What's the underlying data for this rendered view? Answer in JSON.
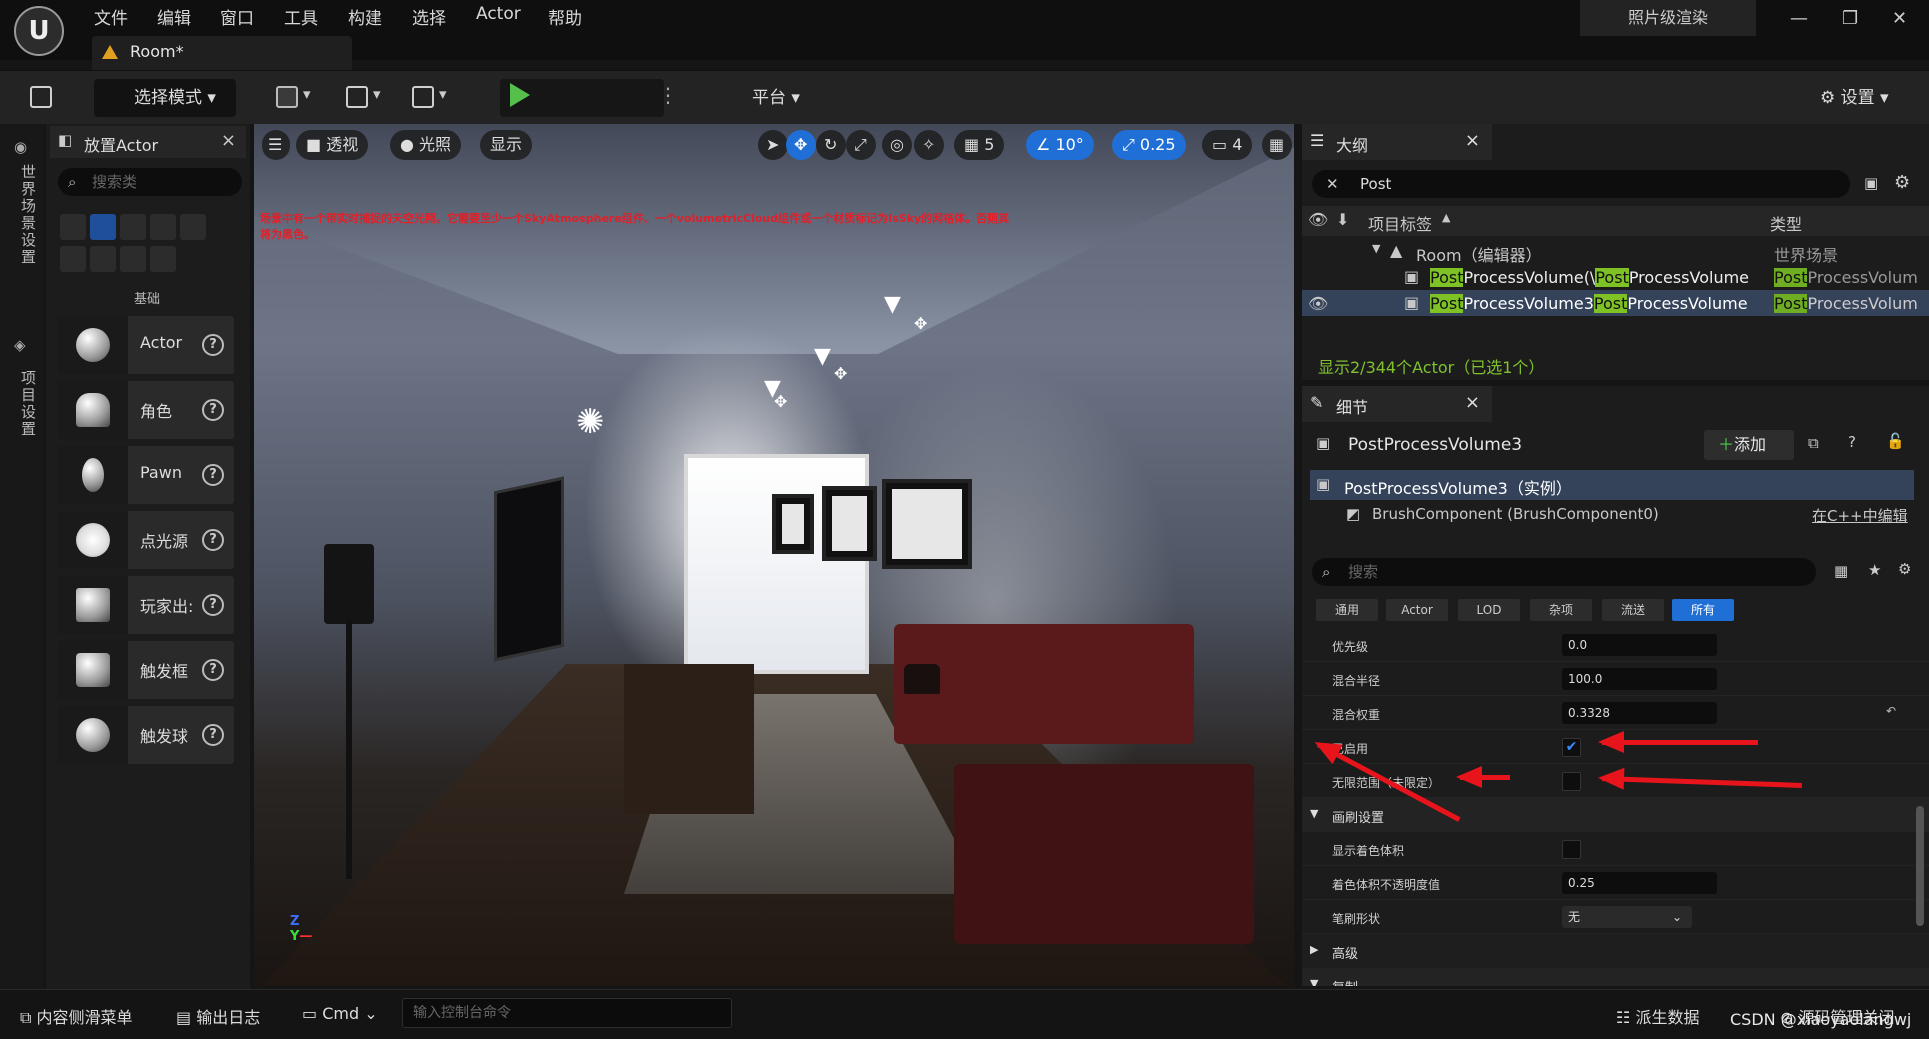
{
  "menu": {
    "items": [
      "文件",
      "编辑",
      "窗口",
      "工具",
      "构建",
      "选择",
      "Actor",
      "帮助"
    ],
    "doc_tab": "Room*",
    "photo_render": "照片级渲染"
  },
  "toolbar": {
    "mode": "选择模式",
    "platform": "平台",
    "settings": "设置"
  },
  "left_rail": {
    "world_settings": "世界场景设置",
    "project_settings": "项目设置"
  },
  "place_actor": {
    "title": "放置Actor",
    "search_placeholder": "搜索类",
    "section": "基础",
    "items": [
      {
        "label": "Actor"
      },
      {
        "label": "角色"
      },
      {
        "label": "Pawn"
      },
      {
        "label": "点光源"
      },
      {
        "label": "玩家出:"
      },
      {
        "label": "触发框"
      },
      {
        "label": "触发球"
      }
    ]
  },
  "viewport": {
    "perspective": "透视",
    "lighting": "光照",
    "show": "显示",
    "grid": "5",
    "rotation": "10°",
    "scale": "0.25",
    "camera_speed": "4",
    "warning": "场景中有一个带实时捕捉的天空光照。它需要至少一个SkyAtmosphere组件、一个volumetricCloud组件或一个材质标记为IsSky的网格体。否则其将为黑色。",
    "axis_z": "Z",
    "axis_y": "Y"
  },
  "outliner": {
    "title": "大纲",
    "search": "Post",
    "col_label": "项目标签",
    "col_type": "类型",
    "root": {
      "label": "Room（编辑器）",
      "type": "世界场景"
    },
    "rows": [
      {
        "hl": "Post",
        "label": "ProcessVolume(\\",
        "hl2": "Post",
        "label2": "ProcessVolume",
        "type_hl": "Post",
        "type": "ProcessVolum"
      },
      {
        "hl": "Post",
        "label": "ProcessVolume3",
        "hl2": "Post",
        "label2": "ProcessVolume",
        "type_hl": "Post",
        "type": "ProcessVolum"
      }
    ],
    "count": "显示2/344个Actor（已选1个）"
  },
  "details": {
    "title": "细节",
    "object": "PostProcessVolume3",
    "add": "添加",
    "instance": "PostProcessVolume3（实例）",
    "component": "BrushComponent (BrushComponent0)",
    "edit_cpp": "在C++中编辑",
    "search_placeholder": "搜索",
    "filters": [
      "通用",
      "Actor",
      "LOD",
      "杂项",
      "流送",
      "所有"
    ],
    "props": [
      {
        "name": "优先级",
        "value": "0.0"
      },
      {
        "name": "混合半径",
        "value": "100.0"
      },
      {
        "name": "混合权重",
        "value": "0.3328"
      }
    ],
    "enabled": "已启用",
    "unbound": "无限范围（未限定）",
    "brush_settings": "画刷设置",
    "show_shader": "显示着色体积",
    "shader_opacity": {
      "name": "着色体积不透明度值",
      "value": "0.25"
    },
    "brush_shape": {
      "name": "笔刷形状",
      "value": "无"
    },
    "advanced": "高级",
    "replication": "复制"
  },
  "bottombar": {
    "content_drawer": "内容侧滑菜单",
    "output_log": "输出日志",
    "cmd": "Cmd",
    "cmd_placeholder": "输入控制台命令",
    "derived_data": "派生数据",
    "source_control": "源码管理关闭",
    "watermark": "CSDN @xiaoyaolangwj"
  }
}
